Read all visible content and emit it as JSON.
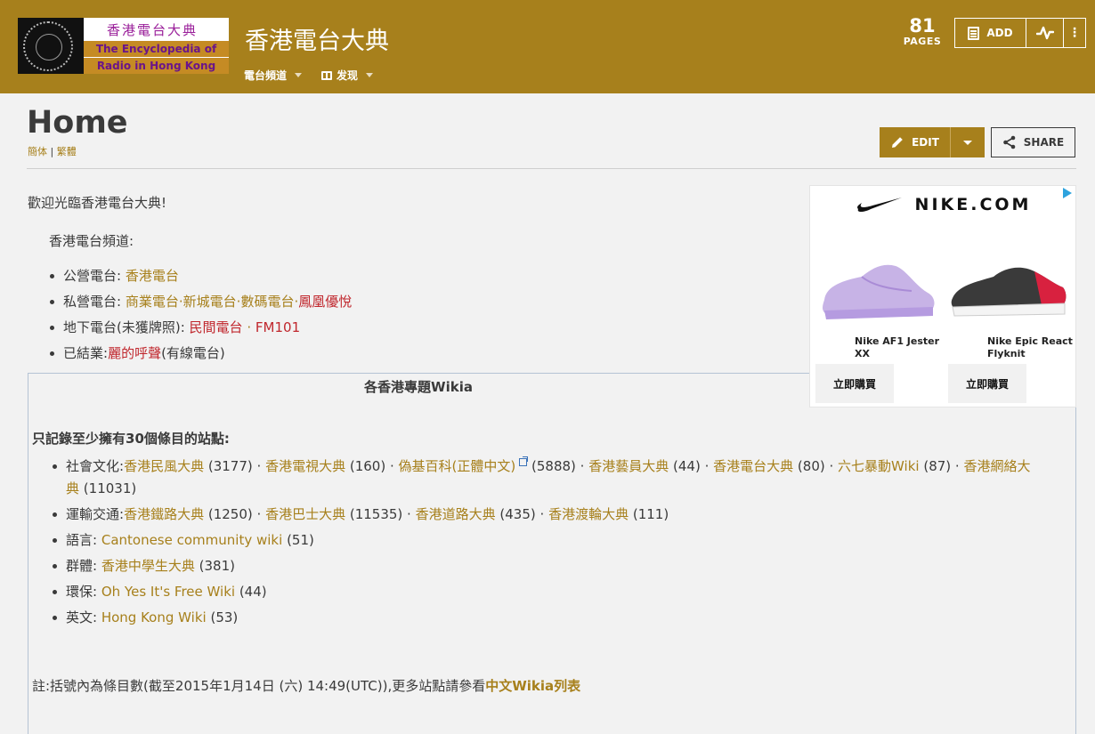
{
  "header": {
    "logo": {
      "cn_text": "香港電台大典",
      "en_line1": "The Encyclopedia of",
      "en_line2": "Radio in Hong Kong"
    },
    "site_title": "香港電台大典",
    "nav": [
      {
        "label": "電台頻道"
      },
      {
        "label": "发现",
        "icon": "book-icon"
      }
    ],
    "pages_count": "81",
    "pages_label": "PAGES",
    "add_label": "ADD",
    "colors": {
      "accent": "#a7801c",
      "background": "#f2f2f2",
      "link_red": "#c0272d"
    }
  },
  "page": {
    "title": "Home",
    "lang_simplified": "簡体",
    "lang_separator": "|",
    "lang_traditional": "繁體",
    "edit_label": "EDIT",
    "share_label": "SHARE"
  },
  "content": {
    "welcome": "歡迎光臨香港電台大典!",
    "channels_heading": "香港電台頻道:",
    "channels": {
      "public": {
        "label": "公營電台:",
        "link": "香港電台"
      },
      "private": {
        "label": "私營電台:",
        "link1": "商業電台",
        "dot1": "·",
        "link2": "新城電台",
        "dot2": "·",
        "link3": "數碼電台",
        "dot3": "·",
        "link4": "鳳凰優悅"
      },
      "underground": {
        "label": "地下電台(未獲牌照):",
        "link1": "民間電台",
        "dot": "·",
        "link2": "FM101"
      },
      "closed": {
        "label": "已結業:",
        "link": "麗的呼聲",
        "suffix": "(有線電台)"
      }
    },
    "wikia_box": {
      "title": "各香港專題Wikia",
      "subtitle": "只記錄至少擁有30個條目的站點:",
      "society": {
        "label": "社會文化:",
        "l1": "香港民風大典",
        "c1": "(3177) ·",
        "l2": "香港電視大典",
        "c2": "(160) ·",
        "l3": "偽基百科(正體中文)",
        "c3": "(5888) ·",
        "l4": "香港藝員大典",
        "c4": "(44) ·",
        "l5": "香港電台大典",
        "c5": "(80) ·",
        "l6": "六七暴動Wiki",
        "c6": "(87) ·",
        "l7": "香港網絡大典",
        "c7": "(11031)"
      },
      "transport": {
        "label": "運輸交通:",
        "l1": "香港鐵路大典",
        "c1": "(1250) ·",
        "l2": "香港巴士大典",
        "c2": "(11535) ·",
        "l3": "香港道路大典",
        "c3": "(435) ·",
        "l4": "香港渡輪大典",
        "c4": "(111)"
      },
      "language": {
        "label": "語言:",
        "link": "Cantonese community wiki",
        "count": "(51)"
      },
      "groups": {
        "label": "群體:",
        "link": "香港中學生大典",
        "count": "(381)"
      },
      "environment": {
        "label": "環保:",
        "link": "Oh Yes It's Free Wiki",
        "count": "(44)"
      },
      "english": {
        "label": "英文:",
        "link": "Hong Kong Wiki",
        "count": "(53)"
      },
      "note_text": "註:括號內為條目數(截至2015年1月14日 (六) 14:49(UTC)),更多站點請參看",
      "note_link": "中文Wikia列表"
    }
  },
  "ad": {
    "brand": "NIKE.COM",
    "product1": "Nike AF1 Jester XX",
    "product2": "Nike Epic React Flyknit",
    "buy_label": "立即購買"
  }
}
